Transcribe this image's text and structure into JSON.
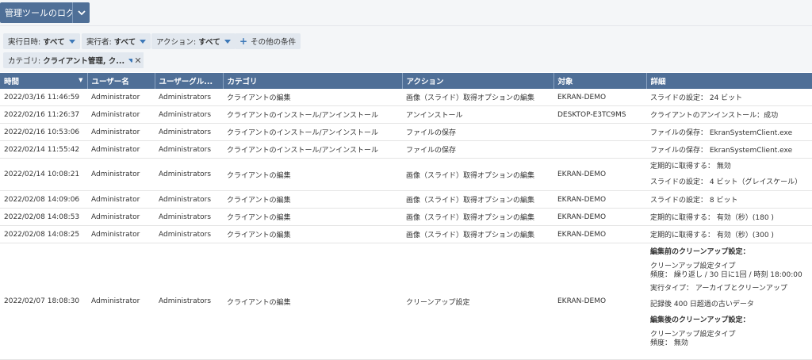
{
  "header": {
    "title": "管理ツールのログ"
  },
  "filters": {
    "exec_date": {
      "label": "実行日時:",
      "value": "すべて"
    },
    "executor": {
      "label": "実行者:",
      "value": "すべて"
    },
    "action": {
      "label": "アクション:",
      "value": "すべて"
    },
    "other": {
      "label": "その他の条件"
    },
    "category": {
      "label": "カテゴリ:",
      "value": "クライアント管理, ク..."
    }
  },
  "table": {
    "headers": [
      "時間",
      "ユーザー名",
      "ユーザーグル...",
      "カテゴリ",
      "アクション",
      "対象",
      "詳細"
    ],
    "rows": [
      {
        "time": "2022/03/16 11:46:59",
        "user": "Administrator",
        "group": "Administrators",
        "category": "クライアントの編集",
        "action": "画像（スライド）取得オプションの編集",
        "target": "EKRAN-DEMO",
        "details": [
          "スライドの設定： 24 ビット"
        ]
      },
      {
        "time": "2022/02/16 11:26:37",
        "user": "Administrator",
        "group": "Administrators",
        "category": "クライアントのインストール/アンインストール",
        "action": "アンインストール",
        "target": "DESKTOP-E3TC9MS",
        "details": [
          "クライアントのアンインストール：成功"
        ]
      },
      {
        "time": "2022/02/16 10:53:06",
        "user": "Administrator",
        "group": "Administrators",
        "category": "クライアントのインストール/アンインストール",
        "action": "ファイルの保存",
        "target": "",
        "details": [
          "ファイルの保存： EkranSystemClient.exe"
        ]
      },
      {
        "time": "2022/02/14 11:55:42",
        "user": "Administrator",
        "group": "Administrators",
        "category": "クライアントのインストール/アンインストール",
        "action": "ファイルの保存",
        "target": "",
        "details": [
          "ファイルの保存： EkranSystemClient.exe"
        ]
      },
      {
        "time": "2022/02/14 10:08:21",
        "user": "Administrator",
        "group": "Administrators",
        "category": "クライアントの編集",
        "action": "画像（スライド）取得オプションの編集",
        "target": "EKRAN-DEMO",
        "details": [
          "定期的に取得する： 無効",
          "スライドの設定： 4 ビット（グレイスケール）"
        ]
      },
      {
        "time": "2022/02/08 14:09:06",
        "user": "Administrator",
        "group": "Administrators",
        "category": "クライアントの編集",
        "action": "画像（スライド）取得オプションの編集",
        "target": "EKRAN-DEMO",
        "details": [
          "スライドの設定： 8 ビット"
        ]
      },
      {
        "time": "2022/02/08 14:08:53",
        "user": "Administrator",
        "group": "Administrators",
        "category": "クライアントの編集",
        "action": "画像（スライド）取得オプションの編集",
        "target": "EKRAN-DEMO",
        "details": [
          "定期的に取得する： 有効（秒）(180 )"
        ]
      },
      {
        "time": "2022/02/08 14:08:25",
        "user": "Administrator",
        "group": "Administrators",
        "category": "クライアントの編集",
        "action": "画像（スライド）取得オプションの編集",
        "target": "EKRAN-DEMO",
        "details": [
          "定期的に取得する： 有効（秒）(300 )"
        ]
      }
    ],
    "big_row": {
      "time": "2022/02/07 18:08:30",
      "user": "Administrator",
      "group": "Administrators",
      "category": "クライアントの編集",
      "action": "クリーンアップ設定",
      "target": "EKRAN-DEMO",
      "before_title": "編集前のクリーンアップ設定：",
      "before_type": "クリーンアップ設定タイプ",
      "before_freq": "頻度： 繰り返し / 30 日に1回 / 時刻 18:00:00",
      "exec_type": "実行タイプ： アーカイブとクリーンアップ",
      "records": "記録後 400 日超過の古いデータ",
      "after_title": "編集後のクリーンアップ設定：",
      "after_type": "クリーンアップ設定タイプ",
      "after_freq": "頻度： 無効"
    }
  }
}
